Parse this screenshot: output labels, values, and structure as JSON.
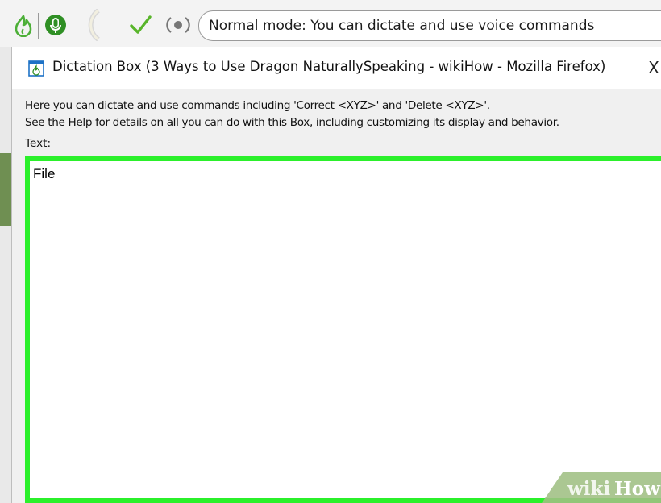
{
  "toolbar": {
    "status_text": "Normal mode: You can dictate and use voice commands",
    "icons": [
      "dragon-flame-icon",
      "microphone-icon",
      "volume-meter-icon",
      "checkmark-icon",
      "speaker-icon"
    ],
    "colors": {
      "flame": "#4caf37",
      "mic": "#2f8f24",
      "check": "#58b52a"
    }
  },
  "window": {
    "title": "Dictation Box (3 Ways to Use Dragon NaturallySpeaking - wikiHow - Mozilla Firefox)",
    "close_label": "X",
    "help_line_1": "Here you can dictate and use commands including 'Correct <XYZ>' and 'Delete <XYZ>'.",
    "help_line_2": "See the Help for details on all you can do with this Box, including customizing its display and behavior.",
    "text_label": "Text:",
    "text_value": "File",
    "highlight_color": "#2bf02b"
  },
  "watermark": {
    "part1": "wiki",
    "part2": "How"
  }
}
